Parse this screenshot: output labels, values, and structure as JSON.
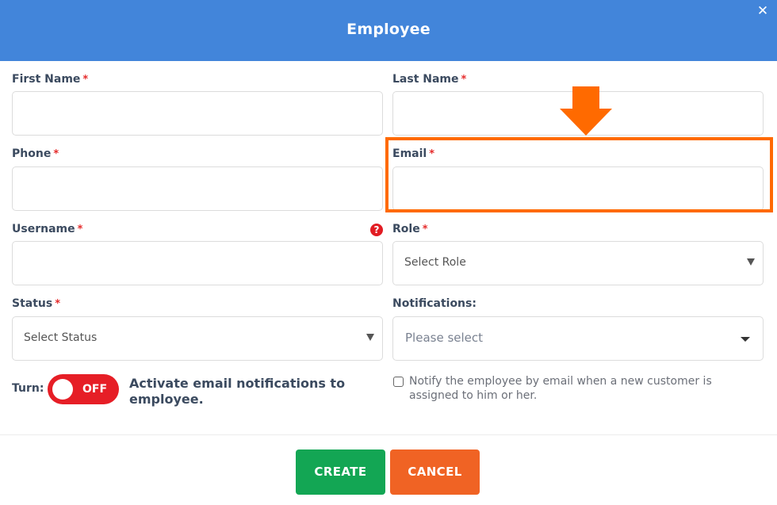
{
  "dialog": {
    "title": "Employee",
    "close_icon": "close-icon"
  },
  "fields": {
    "first_name": {
      "label": "First Name",
      "required": "*",
      "value": ""
    },
    "last_name": {
      "label": "Last Name",
      "required": "*",
      "value": ""
    },
    "phone": {
      "label": "Phone",
      "required": "*",
      "value": ""
    },
    "email": {
      "label": "Email",
      "required": "*",
      "value": ""
    },
    "username": {
      "label": "Username",
      "required": "*",
      "value": "",
      "help_icon": "question-circle-icon"
    },
    "role": {
      "label": "Role",
      "required": "*",
      "selected": "Select Role"
    },
    "status": {
      "label": "Status",
      "required": "*",
      "selected": "Select Status"
    },
    "notifications": {
      "label": "Notifications:",
      "selected": "Please select"
    }
  },
  "toggle": {
    "label": "Turn:",
    "state": "OFF",
    "description": "Activate email notifications to employee."
  },
  "checkbox": {
    "checked": false,
    "label": "Notify the employee by email when a new customer is assigned to him or her."
  },
  "annotation": {
    "highlight_color": "#ff6a00",
    "arrow_icon": "arrow-down-icon"
  },
  "buttons": {
    "create": "CREATE",
    "cancel": "CANCEL"
  },
  "colors": {
    "header": "#4285da",
    "create": "#13a654",
    "cancel": "#f06324",
    "toggle_off": "#e61e26",
    "required": "#e52b2b"
  }
}
